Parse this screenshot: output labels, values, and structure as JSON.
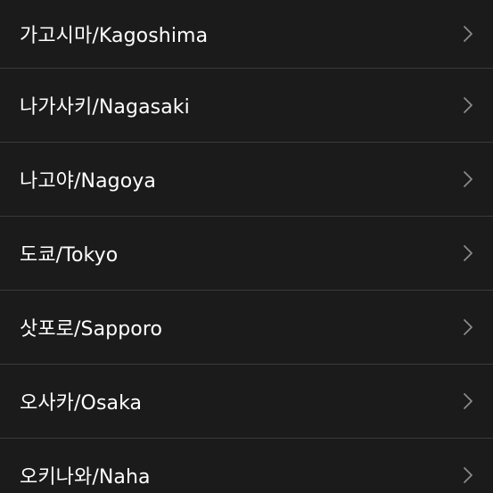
{
  "cities": [
    {
      "label": "가고시마/Kagoshima",
      "icon": "chevron-right-icon"
    },
    {
      "label": "나가사키/Nagasaki",
      "icon": "chevron-right-icon"
    },
    {
      "label": "나고야/Nagoya",
      "icon": "chevron-right-icon"
    },
    {
      "label": "도쿄/Tokyo",
      "icon": "chevron-right-icon"
    },
    {
      "label": "삿포로/Sapporo",
      "icon": "chevron-right-icon"
    },
    {
      "label": "오사카/Osaka",
      "icon": "chevron-right-icon"
    },
    {
      "label": "오키나와/Naha",
      "icon": "chevron-right-icon"
    }
  ],
  "colors": {
    "background": "#1b1b1b",
    "text": "#ffffff",
    "divider": "#3a3a3a",
    "chevron": "#8a8a8a"
  }
}
